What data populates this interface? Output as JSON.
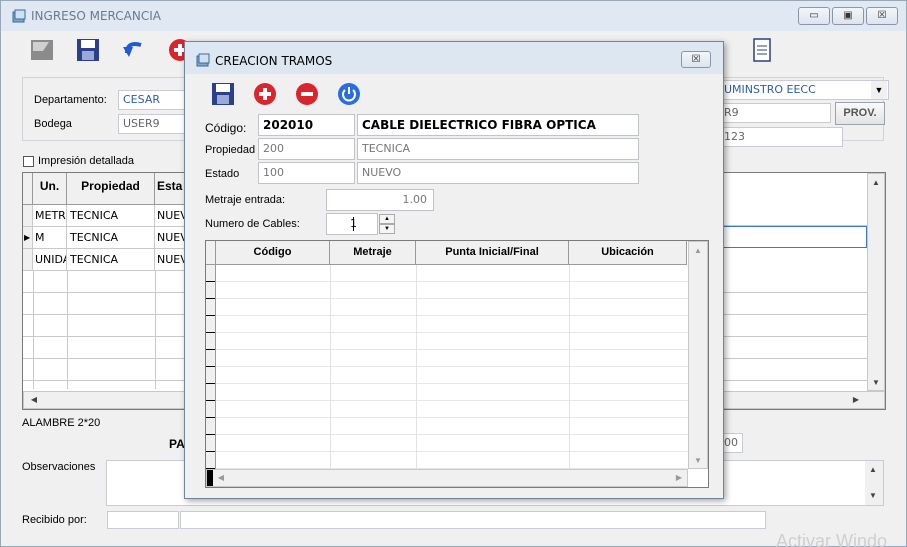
{
  "main_window": {
    "title": "INGRESO MERCANCIA",
    "caption_buttons": {
      "minimize": "▭",
      "maximize": "▣",
      "close": "☒"
    },
    "departamento_label": "Departamento:",
    "departamento_value": "CESAR",
    "bodega_label": "Bodega",
    "bodega_value": "USER9",
    "suministro_value": "UMINSTRO EECC",
    "right_field_2": "R9",
    "right_field_3": "123",
    "prov_button": "PROV.",
    "impresion_label": "Impresión detallada",
    "grid": {
      "headers": [
        "Un.",
        "Propiedad",
        "Esta"
      ],
      "rows": [
        [
          "METR",
          "TECNICA",
          "NUEV"
        ],
        [
          "M",
          "TECNICA",
          "NUEV"
        ],
        [
          "UNIDA",
          "TECNICA",
          "NUEV"
        ]
      ]
    },
    "alambre_text": "ALAMBRE 2*20",
    "pa_text": "PA",
    "right_value_00": "00",
    "observaciones_label": "Observaciones",
    "recibido_label": "Recibido por:",
    "watermark": "Activar Windo"
  },
  "dialog": {
    "title": "CREACION TRAMOS",
    "close_button": "☒",
    "codigo_label": "Código:",
    "codigo_value": "202010",
    "codigo_desc": "CABLE DIELECTRICO FIBRA OPTICA",
    "propiedad_label": "Propiedad",
    "propiedad_value": "200",
    "propiedad_desc": "TECNICA",
    "estado_label": "Estado",
    "estado_value": "100",
    "estado_desc": "NUEVO",
    "metraje_label": "Metraje entrada:",
    "metraje_value": "1.00",
    "cables_label": "Numero de Cables:",
    "cables_value": "1",
    "grid_headers": [
      "Código",
      "Metraje",
      "Punta Inicial/Final",
      "Ubicación"
    ]
  }
}
